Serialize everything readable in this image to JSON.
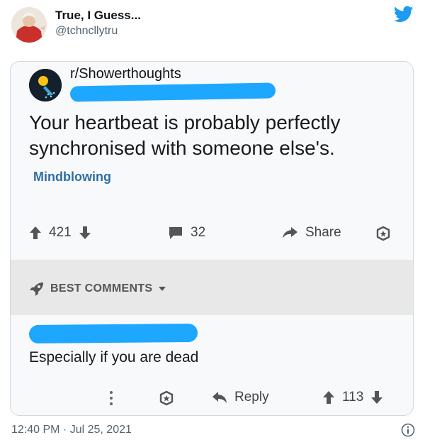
{
  "tweet": {
    "author_name": "True, I Guess...",
    "author_handle": "@tchncllytru",
    "timestamp": "12:40 PM · Jul 25, 2021",
    "brand_color": "#1d9bf0"
  },
  "post": {
    "subreddit": "r/Showerthoughts",
    "title": "Your heartbeat is probably perfectly synchronised with someone else's.",
    "flair": "Mindblowing",
    "upvotes": "421",
    "comments": "32",
    "share_label": "Share"
  },
  "comments_section": {
    "header": "BEST COMMENTS",
    "top_comment": {
      "text": "Especially if you are dead",
      "reply_label": "Reply",
      "votes": "113"
    }
  },
  "icons": [
    "twitter-bird-icon",
    "subreddit-icon",
    "upvote-icon",
    "downvote-icon",
    "comment-icon",
    "share-icon",
    "award-icon",
    "rocket-icon",
    "chevron-down-icon",
    "more-icon",
    "reply-icon",
    "info-icon"
  ],
  "colors": {
    "redaction": "#1ea7ff",
    "flair": "#2e6da4"
  }
}
